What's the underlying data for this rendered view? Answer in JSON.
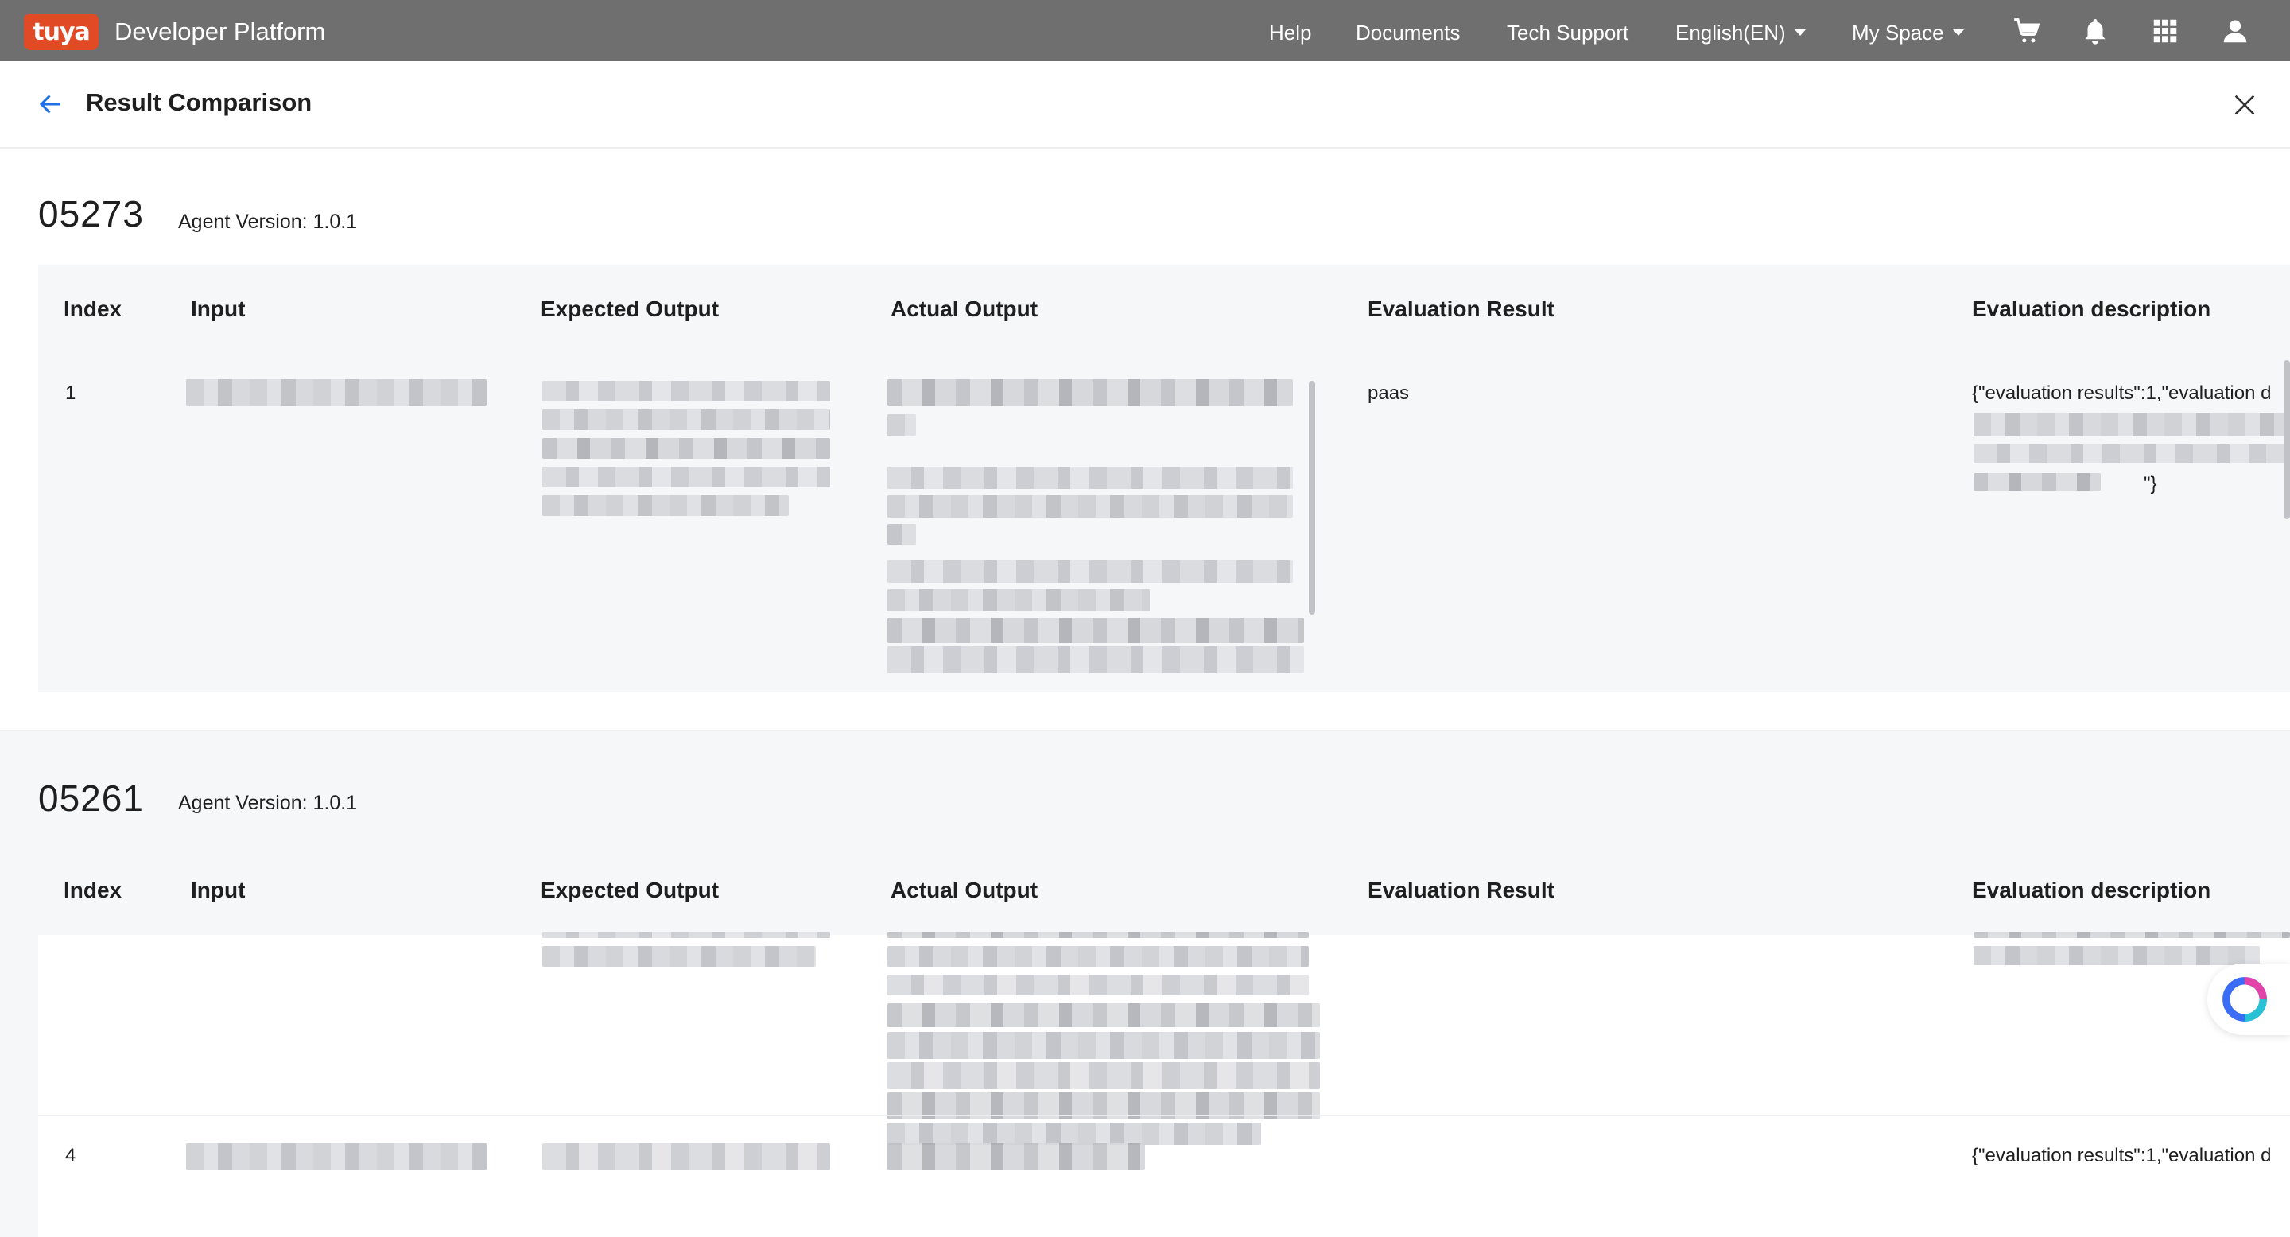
{
  "topbar": {
    "logo_text": "tuya",
    "brand": "Developer Platform",
    "nav": {
      "help": "Help",
      "documents": "Documents",
      "tech_support": "Tech Support",
      "language": "English(EN)",
      "my_space": "My Space"
    }
  },
  "header": {
    "title": "Result Comparison"
  },
  "columns": {
    "index": "Index",
    "input": "Input",
    "expected": "Expected Output",
    "actual": "Actual Output",
    "eval_result": "Evaluation Result",
    "eval_desc": "Evaluation description"
  },
  "sections": [
    {
      "id": "05273",
      "version": "Agent Version: 1.0.1",
      "rows": [
        {
          "index": "1",
          "eval_result": "paas",
          "eval_desc_start": "{\"evaluation results\":1,\"evaluation d",
          "eval_desc_end": "\"}"
        }
      ]
    },
    {
      "id": "05261",
      "version": "Agent Version: 1.0.1",
      "rows": [
        {
          "index": "4",
          "eval_desc_start": "{\"evaluation results\":1,\"evaluation d"
        }
      ]
    }
  ],
  "colors": {
    "topbar": "#6f6f6f",
    "logo": "#e04a25",
    "accent": "#1f6fe6",
    "table_bg": "#f6f7f9"
  }
}
